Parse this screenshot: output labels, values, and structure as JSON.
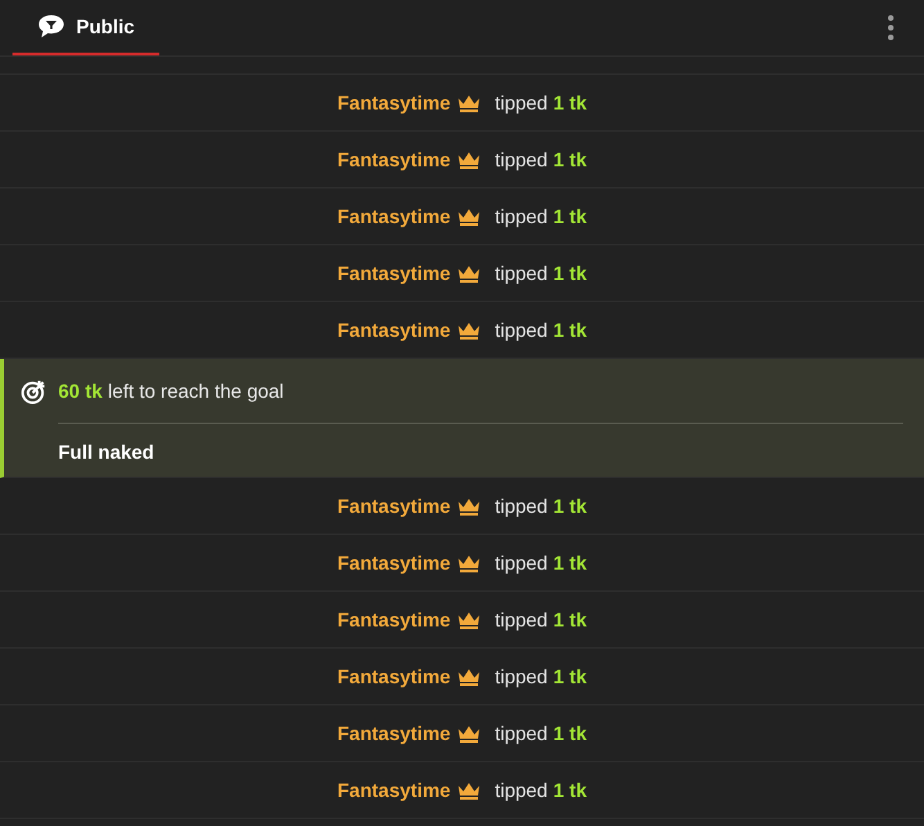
{
  "tabs": [
    {
      "label": "Public",
      "selected": true
    }
  ],
  "messages": [
    {
      "kind": "tip",
      "user": "Fantasytime",
      "verb": "tipped",
      "amount": "1 tk"
    },
    {
      "kind": "tip",
      "user": "Fantasytime",
      "verb": "tipped",
      "amount": "1 tk"
    },
    {
      "kind": "tip",
      "user": "Fantasytime",
      "verb": "tipped",
      "amount": "1 tk"
    },
    {
      "kind": "tip",
      "user": "Fantasytime",
      "verb": "tipped",
      "amount": "1 tk"
    },
    {
      "kind": "tip",
      "user": "Fantasytime",
      "verb": "tipped",
      "amount": "1 tk"
    },
    {
      "kind": "goal",
      "amount": "60 tk",
      "text": "left to reach the goal",
      "goal": "Full naked"
    },
    {
      "kind": "tip",
      "user": "Fantasytime",
      "verb": "tipped",
      "amount": "1 tk"
    },
    {
      "kind": "tip",
      "user": "Fantasytime",
      "verb": "tipped",
      "amount": "1 tk"
    },
    {
      "kind": "tip",
      "user": "Fantasytime",
      "verb": "tipped",
      "amount": "1 tk"
    },
    {
      "kind": "tip",
      "user": "Fantasytime",
      "verb": "tipped",
      "amount": "1 tk"
    },
    {
      "kind": "tip",
      "user": "Fantasytime",
      "verb": "tipped",
      "amount": "1 tk"
    },
    {
      "kind": "tip",
      "user": "Fantasytime",
      "verb": "tipped",
      "amount": "1 tk"
    }
  ]
}
